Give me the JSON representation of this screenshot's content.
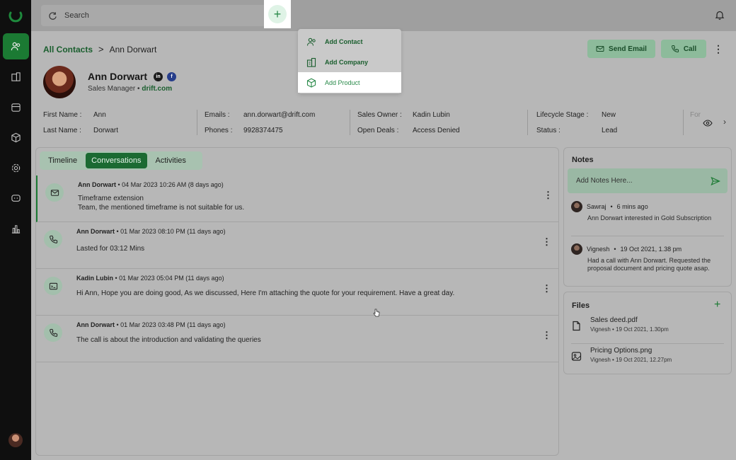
{
  "colors": {
    "accent": "#1b7a33",
    "sidebar": "#0f0f0f",
    "overlay": "#b7b7b7"
  },
  "sidebar": {
    "items": [
      {
        "name": "contacts-icon",
        "active": true
      },
      {
        "name": "company-icon",
        "active": false
      },
      {
        "name": "calendar-icon",
        "active": false
      },
      {
        "name": "product-icon",
        "active": false
      },
      {
        "name": "settings-icon",
        "active": false
      },
      {
        "name": "chat-icon",
        "active": false
      },
      {
        "name": "reports-icon",
        "active": false
      }
    ]
  },
  "topbar": {
    "search_placeholder": "Search",
    "add_symbol": "+"
  },
  "add_menu": {
    "items": [
      {
        "label": "Add Contact",
        "icon": "contact-icon"
      },
      {
        "label": "Add Company",
        "icon": "company-icon"
      },
      {
        "label": "Add Product",
        "icon": "product-icon"
      }
    ]
  },
  "breadcrumb": {
    "parent": "All Contacts",
    "separator": ">",
    "current": "Ann Dorwart"
  },
  "actions": {
    "send_email": "Send Email",
    "call": "Call",
    "more": "⋮"
  },
  "profile": {
    "name": "Ann Dorwart",
    "role": "Sales Manager",
    "bullet": "•",
    "company": "drift.com",
    "linkedin": "in",
    "facebook": "f"
  },
  "details": {
    "first_name_label": "First Name :",
    "first_name": "Ann",
    "last_name_label": "Last Name :",
    "last_name": "Dorwart",
    "emails_label": "Emails :",
    "email": "ann.dorwart@drift.com",
    "phones_label": "Phones :",
    "phone": "9928374475",
    "owner_label": "Sales Owner :",
    "owner": "Kadin Lubin",
    "deals_label": "Open Deals :",
    "deals": "Access Denied",
    "lifecycle_label": "Lifecycle Stage :",
    "lifecycle": "New",
    "status_label": "Status :",
    "status": "Lead",
    "more_label": "For"
  },
  "tabs": [
    "Timeline",
    "Conversations",
    "Activities"
  ],
  "conversations": [
    {
      "author": "Ann Dorwart",
      "time": "04 Mar 2023 10:26 AM (8 days ago)",
      "line1": "Timeframe extension",
      "line2": "Team, the mentioned timeframe is not suitable for us.",
      "icon": "mail-icon"
    },
    {
      "author": "Ann Dorwart",
      "time": "01 Mar 2023 08:10 PM (11 days ago)",
      "line1": "Lasted for 03:12 Mins",
      "line2": "",
      "icon": "phone-icon"
    },
    {
      "author": "Kadin Lubin",
      "time": "01 Mar 2023 05:04 PM (11 days ago)",
      "line1": "Hi Ann, Hope you are doing good, As we discussed, Here I'm attaching the quote for your requirement. Have a great day.",
      "line2": "",
      "icon": "quote-icon"
    },
    {
      "author": "Ann Dorwart",
      "time": "01 Mar 2023 03:48 PM (11 days ago)",
      "line1": "The call is about the introduction and validating the queries",
      "line2": "",
      "icon": "phone-icon"
    }
  ],
  "notes": {
    "title": "Notes",
    "placeholder": "Add Notes Here...",
    "items": [
      {
        "author": "Sawraj",
        "time": "6 mins ago",
        "text": "Ann Dorwart interested in Gold Subscription"
      },
      {
        "author": "Vignesh",
        "time": "19 Oct 2021, 1.38 pm",
        "text": "Had a call with Ann Dorwart. Requested the proposal document and pricing quote asap."
      }
    ]
  },
  "files": {
    "title": "Files",
    "add": "+",
    "items": [
      {
        "name": "Sales deed.pdf",
        "author": "Vignesh",
        "time": "19 Oct 2021, 1.30pm",
        "icon": "document-icon"
      },
      {
        "name": "Pricing Options.png",
        "author": "Vignesh",
        "time": "19 Oct 2021, 12.27pm",
        "icon": "image-icon"
      }
    ]
  }
}
